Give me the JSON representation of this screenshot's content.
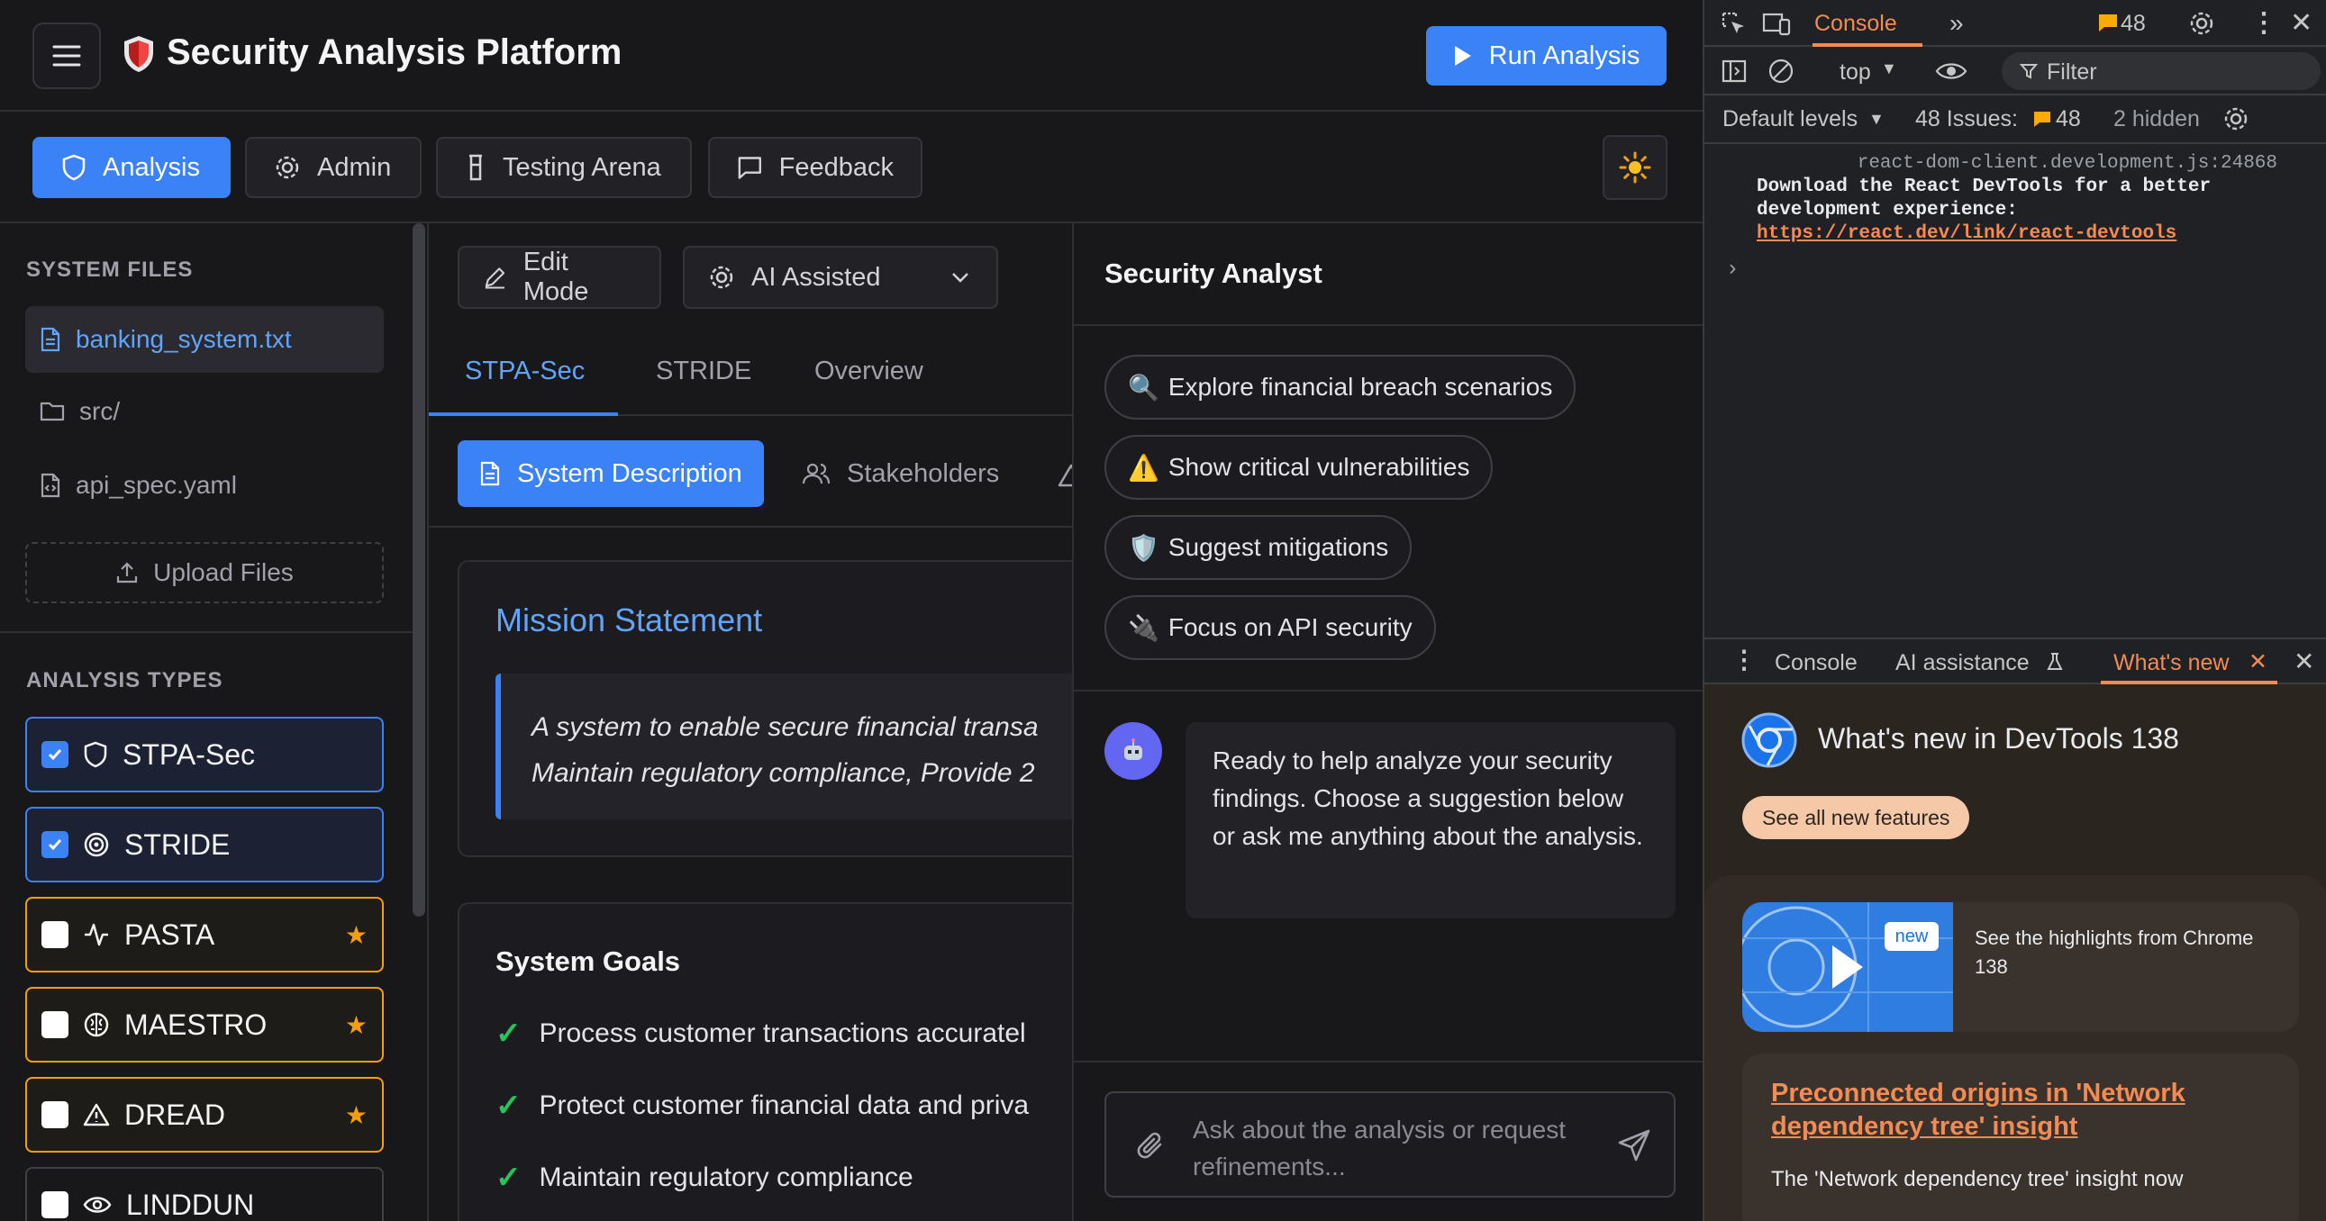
{
  "header": {
    "title": "Security Analysis Platform",
    "run_label": "Run Analysis"
  },
  "nav": {
    "tabs": [
      {
        "label": "Analysis",
        "icon": "shield-icon",
        "active": true
      },
      {
        "label": "Admin",
        "icon": "gear-icon"
      },
      {
        "label": "Testing Arena",
        "icon": "flask-icon"
      },
      {
        "label": "Feedback",
        "icon": "message-icon"
      }
    ],
    "theme_icon": "sun-icon"
  },
  "sidebar": {
    "files_heading": "SYSTEM FILES",
    "files": [
      {
        "name": "banking_system.txt",
        "icon": "file-text-icon",
        "selected": true
      },
      {
        "name": "src/",
        "icon": "folder-icon"
      },
      {
        "name": "api_spec.yaml",
        "icon": "file-code-icon"
      }
    ],
    "upload_label": "Upload Files",
    "types_heading": "ANALYSIS TYPES",
    "types": [
      {
        "name": "STPA-Sec",
        "checked": true,
        "premium": false,
        "icon": "shield-icon"
      },
      {
        "name": "STRIDE",
        "checked": true,
        "premium": false,
        "icon": "target-icon"
      },
      {
        "name": "PASTA",
        "checked": false,
        "premium": true,
        "icon": "activity-icon"
      },
      {
        "name": "MAESTRO",
        "checked": false,
        "premium": true,
        "icon": "brain-icon"
      },
      {
        "name": "DREAD",
        "checked": false,
        "premium": true,
        "icon": "warning-icon"
      },
      {
        "name": "LINDDUN",
        "checked": false,
        "premium": false,
        "icon": "eye-icon"
      }
    ],
    "star": "★"
  },
  "center": {
    "edit_mode": "Edit Mode",
    "ai_mode": "AI Assisted",
    "tabs": [
      "STPA-Sec",
      "STRIDE",
      "Overview"
    ],
    "subtabs": [
      "System Description",
      "Stakeholders"
    ],
    "mission": {
      "title": "Mission Statement",
      "line1": "A system to enable secure financial transa",
      "line2": "Maintain regulatory compliance, Provide 2"
    },
    "goals": {
      "title": "System Goals",
      "items": [
        "Process customer transactions accuratel",
        "Protect customer financial data and priva",
        "Maintain regulatory compliance"
      ]
    }
  },
  "chat": {
    "title": "Security Analyst",
    "suggestions": [
      {
        "emoji": "🔍",
        "label": "Explore financial breach scenarios"
      },
      {
        "emoji": "⚠️",
        "label": "Show critical vulnerabilities"
      },
      {
        "emoji": "🛡️",
        "label": "Suggest mitigations"
      },
      {
        "emoji": "🔌",
        "label": "Focus on API security"
      }
    ],
    "message": "Ready to help analyze your security findings. Choose a suggestion below or ask me anything about the analysis.",
    "input_placeholder": "Ask about the analysis or request refinements..."
  },
  "devtools": {
    "top_tab": "Console",
    "issues_badge": "48",
    "context": "top",
    "filter_placeholder": "Filter",
    "levels": "Default levels",
    "issues_label": "48 Issues:",
    "issues_count": "48",
    "hidden": "2 hidden",
    "log_source": "react-dom-client.development.js:24868",
    "log_line1": "Download the React DevTools for a better",
    "log_line2": "development experience:",
    "log_link": "https://react.dev/link/react-devtools",
    "drawer_tabs": [
      "Console",
      "AI assistance",
      "What's new"
    ],
    "whats_new": {
      "title": "What's new in DevTools 138",
      "see_all": "See all new features",
      "badge": "new",
      "highlight_text": "See the highlights from Chrome 138",
      "article_title": "Preconnected origins in 'Network dependency tree' insight",
      "article_body": "The 'Network dependency tree' insight now"
    }
  },
  "colors": {
    "accent": "#3b82f6",
    "premium": "#f59e0b",
    "success": "#22c55e",
    "devtools_accent": "#f28b54"
  }
}
